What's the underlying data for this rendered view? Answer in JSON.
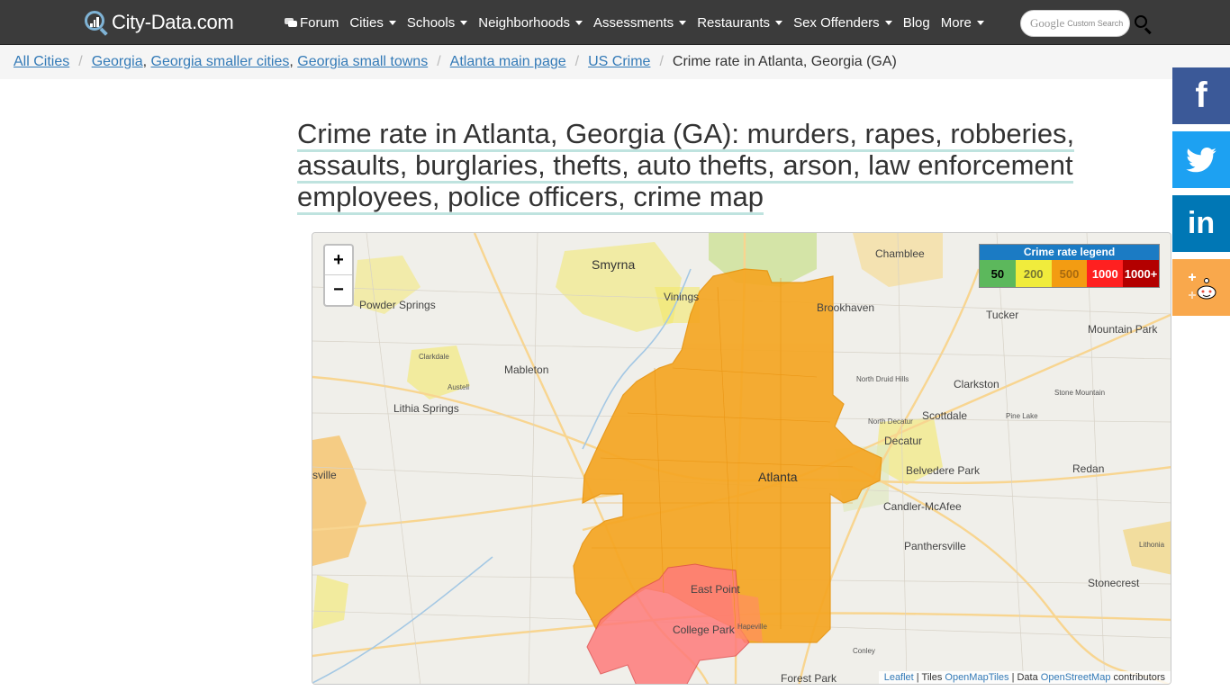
{
  "header": {
    "logo_text": "City-Data.com",
    "nav": [
      {
        "label": "Forum",
        "dropdown": false,
        "icon": "forum-icon"
      },
      {
        "label": "Cities",
        "dropdown": true
      },
      {
        "label": "Schools",
        "dropdown": true
      },
      {
        "label": "Neighborhoods",
        "dropdown": true
      },
      {
        "label": "Assessments",
        "dropdown": true
      },
      {
        "label": "Restaurants",
        "dropdown": true
      },
      {
        "label": "Sex Offenders",
        "dropdown": true
      },
      {
        "label": "Blog",
        "dropdown": false
      },
      {
        "label": "More",
        "dropdown": true
      }
    ],
    "search_brand": "Google",
    "search_placeholder": "Custom Search"
  },
  "breadcrumb": {
    "all_cities": "All Cities",
    "georgia": "Georgia",
    "comma1": ",",
    "ga_smaller": "Georgia smaller cities",
    "comma2": ",",
    "ga_small_towns": "Georgia small towns",
    "atlanta_main": "Atlanta main page",
    "us_crime": "US Crime",
    "current": "Crime rate in Atlanta, Georgia (GA)"
  },
  "page": {
    "title": "Crime rate in Atlanta, Georgia (GA): murders, rapes, robberies, assaults, burglaries, thefts, auto thefts, arson, law enforcement employees, police officers, crime map"
  },
  "map": {
    "zoom_in": "+",
    "zoom_out": "−",
    "legend": {
      "title": "Crime rate legend",
      "items": [
        {
          "label": "50",
          "color": "#5cb85c",
          "text_color": "#000000"
        },
        {
          "label": "200",
          "color": "#f0ec3c",
          "text_color": "#777733"
        },
        {
          "label": "500",
          "color": "#f39c12",
          "text_color": "#a86a10"
        },
        {
          "label": "1000",
          "color": "#ff2020",
          "text_color": "#ffffff"
        },
        {
          "label": "1000+",
          "color": "#b30000",
          "text_color": "#ffffff"
        }
      ]
    },
    "places": {
      "smyrna": "Smyrna",
      "chamblee": "Chamblee",
      "vinings": "Vinings",
      "brookhaven": "Brookhaven",
      "tucker": "Tucker",
      "mountain_park": "Mountain Park",
      "powder_springs": "Powder Springs",
      "mableton": "Mableton",
      "clarkdale": "Clarkdale",
      "austell": "Austell",
      "lithia_springs": "Lithia Springs",
      "clarkston": "Clarkston",
      "north_druid_hills": "North Druid Hills",
      "stone_mountain": "Stone Mountain",
      "scottdale": "Scottdale",
      "pine_lake": "Pine Lake",
      "north_decatur": "North Decatur",
      "decatur": "Decatur",
      "belvedere_park": "Belvedere Park",
      "redan": "Redan",
      "atlanta": "Atlanta",
      "candler_mcafee": "Candler-McAfee",
      "ville": "sville",
      "panthersville": "Panthersville",
      "lithonia": "Lithonia",
      "stonecrest": "Stonecrest",
      "east_point": "East Point",
      "college_park": "College Park",
      "hapeville": "Hapeville",
      "conley": "Conley",
      "forest_park": "Forest Park"
    },
    "attribution": {
      "leaflet": "Leaflet",
      "tiles": "| Tiles",
      "openmaptiles": "OpenMapTiles",
      "data": "| Data",
      "osm": "OpenStreetMap",
      "contributors": "contributors"
    }
  },
  "social": {
    "facebook": "f",
    "twitter": "twitter",
    "linkedin": "in",
    "reddit": "reddit"
  }
}
